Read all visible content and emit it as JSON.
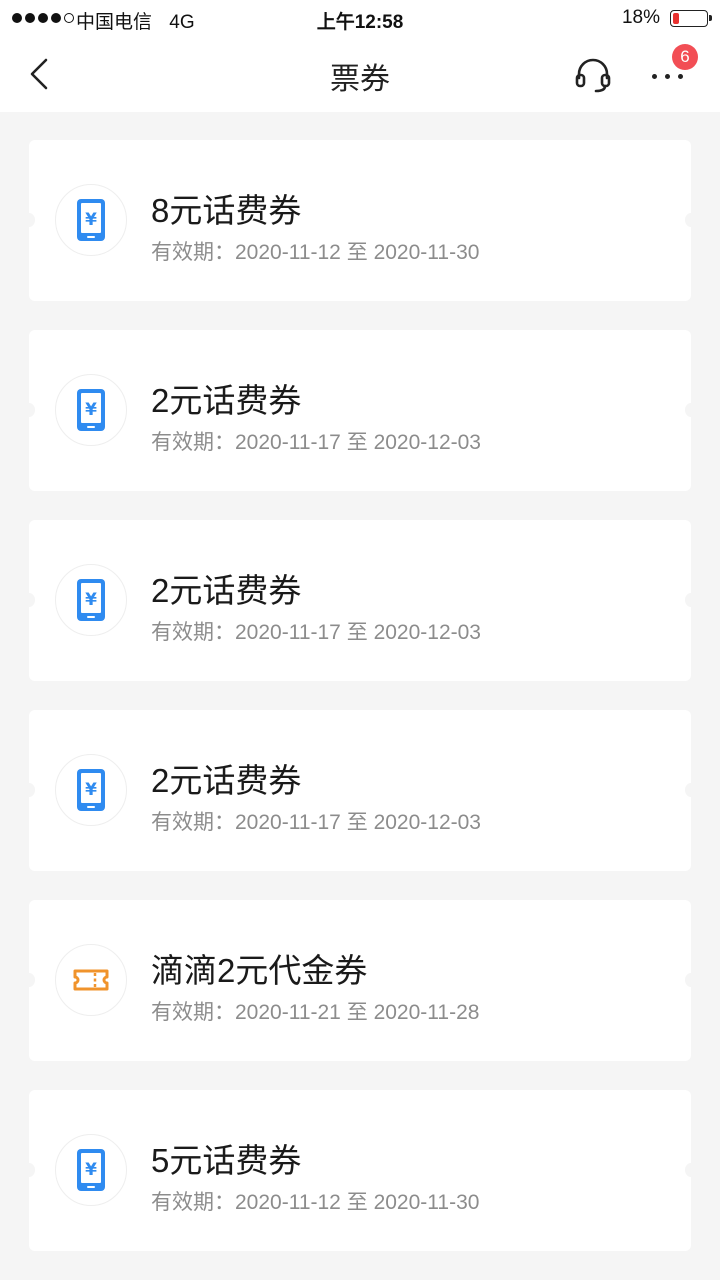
{
  "status_bar": {
    "carrier": "中国电信",
    "network": "4G",
    "time": "上午12:58",
    "battery_percent": "18%",
    "battery_level": 0.18,
    "battery_color": "#e8312f"
  },
  "nav": {
    "title": "票券",
    "more_badge_count": "6"
  },
  "colors": {
    "phone_icon_blue": "#2f8bf0",
    "ticket_icon_orange": "#f0932b",
    "badge_red": "#f24e55"
  },
  "coupons": [
    {
      "title": "8元话费券",
      "validity_label": "有效期：",
      "start": "2020-11-12",
      "sep": "至",
      "end": "2020-11-30",
      "icon": "phone-yuan-icon"
    },
    {
      "title": "2元话费券",
      "validity_label": "有效期：",
      "start": "2020-11-17",
      "sep": "至",
      "end": "2020-12-03",
      "icon": "phone-yuan-icon"
    },
    {
      "title": "2元话费券",
      "validity_label": "有效期：",
      "start": "2020-11-17",
      "sep": "至",
      "end": "2020-12-03",
      "icon": "phone-yuan-icon"
    },
    {
      "title": "2元话费券",
      "validity_label": "有效期：",
      "start": "2020-11-17",
      "sep": "至",
      "end": "2020-12-03",
      "icon": "phone-yuan-icon"
    },
    {
      "title": "滴滴2元代金券",
      "validity_label": "有效期：",
      "start": "2020-11-21",
      "sep": "至",
      "end": "2020-11-28",
      "icon": "ticket-icon"
    },
    {
      "title": "5元话费券",
      "validity_label": "有效期：",
      "start": "2020-11-12",
      "sep": "至",
      "end": "2020-11-30",
      "icon": "phone-yuan-icon"
    }
  ]
}
